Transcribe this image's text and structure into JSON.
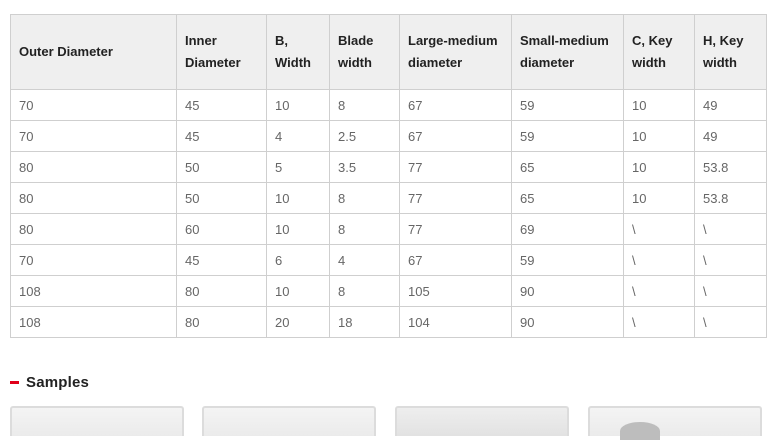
{
  "table": {
    "headers": [
      "Outer Diameter",
      "Inner Diameter",
      "B, Width",
      "Blade width",
      "Large-medium diameter",
      "Small-medium diameter",
      "C, Key width",
      "H, Key width"
    ],
    "rows": [
      [
        "70",
        "45",
        "10",
        "8",
        "67",
        "59",
        "10",
        "49"
      ],
      [
        "70",
        "45",
        "4",
        "2.5",
        "67",
        "59",
        "10",
        "49"
      ],
      [
        "80",
        "50",
        "5",
        "3.5",
        "77",
        "65",
        "10",
        "53.8"
      ],
      [
        "80",
        "50",
        "10",
        "8",
        "77",
        "65",
        "10",
        "53.8"
      ],
      [
        "80",
        "60",
        "10",
        "8",
        "77",
        "69",
        "\\",
        "\\"
      ],
      [
        "70",
        "45",
        "6",
        "4",
        "67",
        "59",
        "\\",
        "\\"
      ],
      [
        "108",
        "80",
        "10",
        "8",
        "105",
        "90",
        "\\",
        "\\"
      ],
      [
        "108",
        "80",
        "20",
        "18",
        "104",
        "90",
        "\\",
        "\\"
      ]
    ]
  },
  "samples": {
    "title": "Samples",
    "accent_color": "#e0001a"
  }
}
